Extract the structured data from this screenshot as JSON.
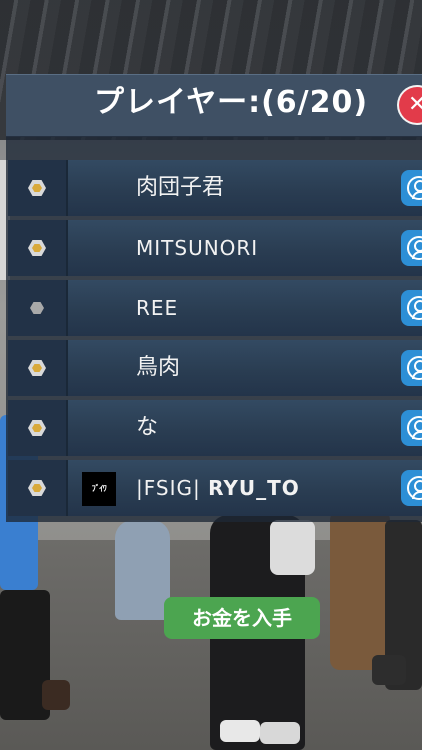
{
  "header": {
    "title": "プレイヤー:(6/20)",
    "close_icon": "close-icon"
  },
  "players": [
    {
      "name": "肉団子君",
      "rank_icon": "gold-hex-icon",
      "has_team_logo": false
    },
    {
      "name": "MITSUNORI",
      "rank_icon": "gold-hex-icon",
      "has_team_logo": false
    },
    {
      "name": "REE",
      "rank_icon": "gray-hex-icon",
      "has_team_logo": false
    },
    {
      "name": "鳥肉",
      "rank_icon": "gold-hex-icon",
      "has_team_logo": false
    },
    {
      "name": "な",
      "rank_icon": "gold-hex-icon",
      "has_team_logo": false
    },
    {
      "name_tag": "|FSIG|",
      "name_main": "RYU_TO",
      "rank_icon": "gold-hex-icon",
      "has_team_logo": true,
      "team_logo_text": "ﾌﾞｲﾜ"
    }
  ],
  "profile_button_icon": "user-profile-icon",
  "get_money_button": {
    "label": "お金を入手"
  },
  "colors": {
    "header_bg": "#3f5064",
    "row_bg": "#2a3d52",
    "close_red": "#e23b4a",
    "profile_blue": "#2d8fd6",
    "money_green": "#4ca550"
  }
}
